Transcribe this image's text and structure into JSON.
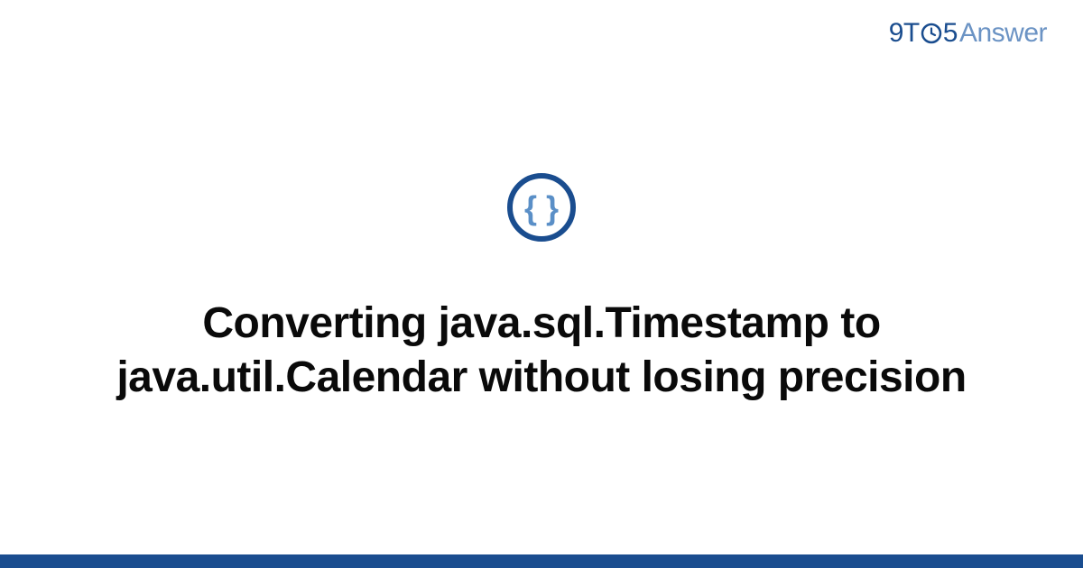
{
  "brand": {
    "part1": "9T",
    "part2": "5",
    "part3": "Answer"
  },
  "title": "Converting java.sql.Timestamp to java.util.Calendar without losing precision",
  "colors": {
    "primary": "#1a4d8f",
    "secondary": "#6b93c4",
    "iconInner": "#5a8fc7"
  }
}
